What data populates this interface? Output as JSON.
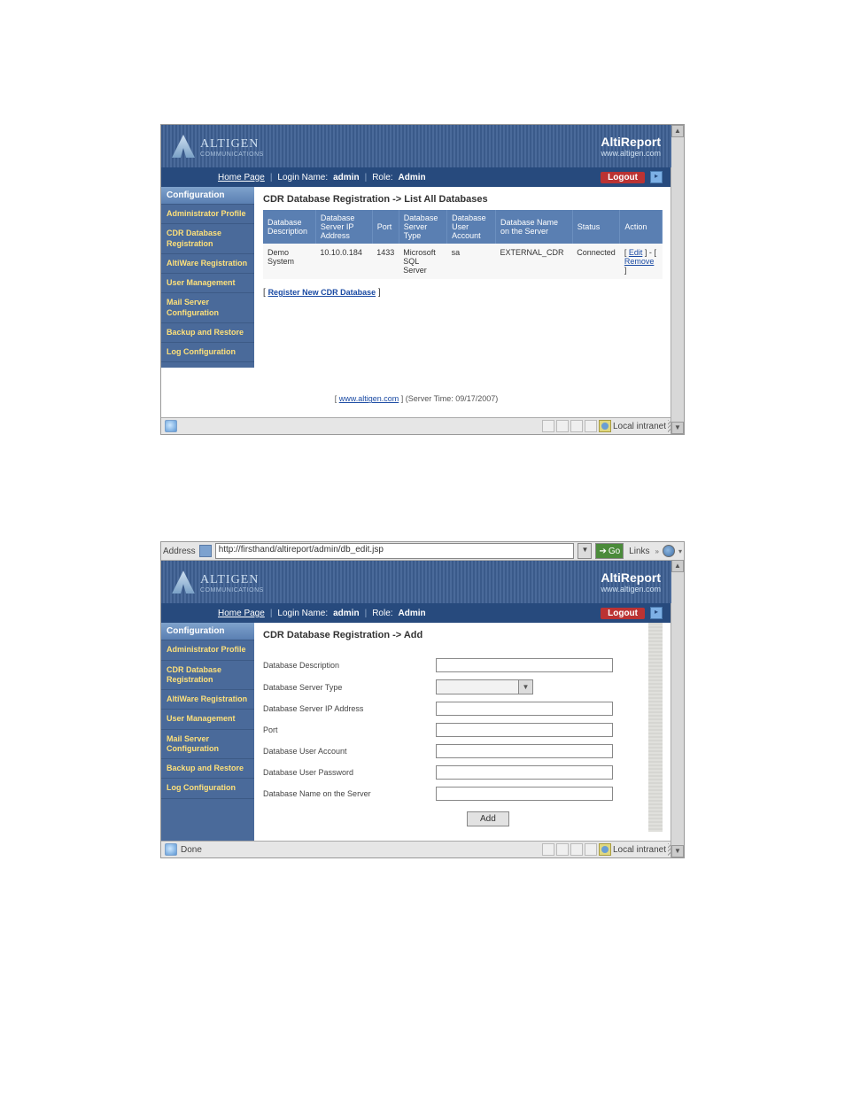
{
  "brand": {
    "title": "AltiReport",
    "url": "www.altigen.com",
    "logo": "ALTIGEN",
    "logo_sub": "COMMUNICATIONS"
  },
  "subbar": {
    "home": "Home Page",
    "login_label": "Login Name:",
    "login_value": "admin",
    "role_label": "Role:",
    "role_value": "Admin",
    "logout": "Logout"
  },
  "sidebar": {
    "header": "Configuration",
    "items": [
      "Administrator Profile",
      "CDR Database Registration",
      "AltiWare Registration",
      "User Management",
      "Mail Server Configuration",
      "Backup and Restore",
      "Log Configuration"
    ]
  },
  "shot1": {
    "title": "CDR Database Registration -> List All Databases",
    "headers": [
      "Database Description",
      "Database Server IP Address",
      "Port",
      "Database Server Type",
      "Database User Account",
      "Database Name on the Server",
      "Status",
      "Action"
    ],
    "row": {
      "desc": "Demo System",
      "ip": "10.10.0.184",
      "port": "1433",
      "type": "Microsoft SQL Server",
      "user": "sa",
      "dbname": "EXTERNAL_CDR",
      "status": "Connected",
      "action_edit": "Edit",
      "action_remove": "Remove"
    },
    "register_link": "Register New CDR Database",
    "footer_link": "www.altigen.com",
    "footer_time": "(Server Time: 09/17/2007)",
    "status_zone": "Local intranet"
  },
  "shot2": {
    "address_label": "Address",
    "address_url": "http://firsthand/altireport/admin/db_edit.jsp",
    "go": "Go",
    "links": "Links",
    "title": "CDR Database Registration -> Add",
    "fields": {
      "desc": "Database Description",
      "type": "Database Server Type",
      "ip": "Database Server IP Address",
      "port": "Port",
      "user": "Database User Account",
      "pass": "Database User Password",
      "dbname": "Database Name on the Server"
    },
    "add_btn": "Add",
    "status_done": "Done",
    "status_zone": "Local intranet"
  }
}
